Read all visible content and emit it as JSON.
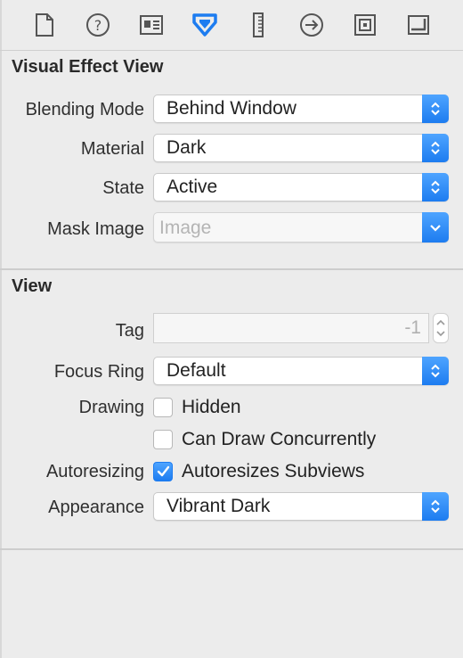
{
  "toolbar": {
    "icons": [
      {
        "name": "file-inspector-icon"
      },
      {
        "name": "help-inspector-icon"
      },
      {
        "name": "identity-inspector-icon"
      },
      {
        "name": "attributes-inspector-icon",
        "selected": true
      },
      {
        "name": "size-inspector-icon"
      },
      {
        "name": "connections-inspector-icon"
      },
      {
        "name": "bindings-inspector-icon"
      },
      {
        "name": "view-effects-inspector-icon"
      }
    ],
    "accent": "#1d7cf0"
  },
  "visual_effect": {
    "title": "Visual Effect View",
    "blending_mode": {
      "label": "Blending Mode",
      "value": "Behind Window"
    },
    "material": {
      "label": "Material",
      "value": "Dark"
    },
    "state": {
      "label": "State",
      "value": "Active"
    },
    "mask_image": {
      "label": "Mask Image",
      "placeholder": "Image"
    }
  },
  "view": {
    "title": "View",
    "tag": {
      "label": "Tag",
      "value": "-1"
    },
    "focus_ring": {
      "label": "Focus Ring",
      "value": "Default"
    },
    "drawing": {
      "label": "Drawing",
      "hidden": {
        "label": "Hidden",
        "checked": false
      },
      "can_draw_concurrently": {
        "label": "Can Draw Concurrently",
        "checked": false
      }
    },
    "autoresizing": {
      "label": "Autoresizing",
      "autoresizes_subviews": {
        "label": "Autoresizes Subviews",
        "checked": true
      }
    },
    "appearance": {
      "label": "Appearance",
      "value": "Vibrant Dark"
    }
  }
}
